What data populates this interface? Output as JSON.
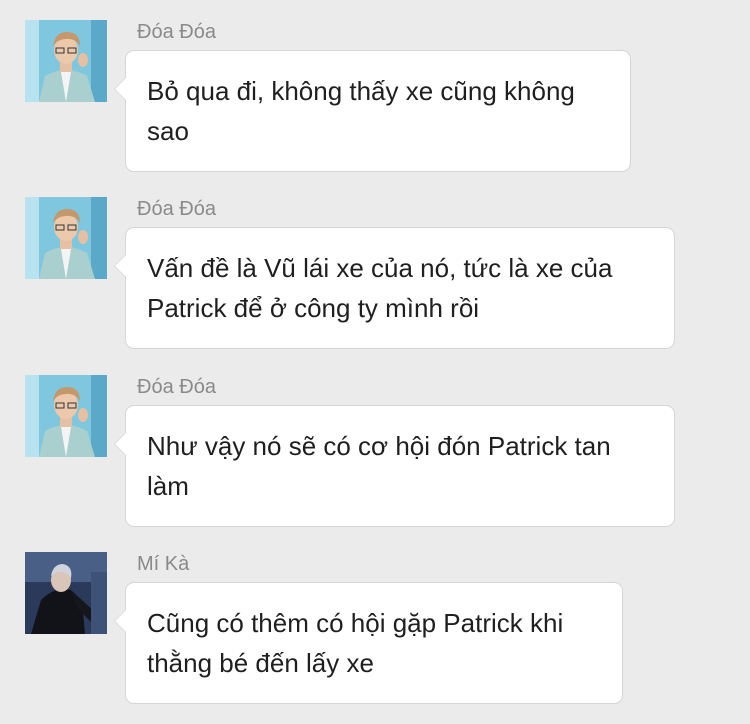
{
  "messages": [
    {
      "sender": "Đóa Đóa",
      "avatar": "avatar-photo",
      "text": "Bỏ qua đi, không thấy xe cũng không sao"
    },
    {
      "sender": "Đóa Đóa",
      "avatar": "avatar-photo",
      "text": "Vấn đề là Vũ lái xe của nó, tức là xe của Patrick để ở công ty mình rồi"
    },
    {
      "sender": "Đóa Đóa",
      "avatar": "avatar-photo",
      "text": "Như vậy nó sẽ có cơ hội đón Patrick tan làm"
    },
    {
      "sender": "Mí Kà",
      "avatar": "avatar-photo",
      "text": "Cũng có thêm có hội gặp Patrick khi thằng bé đến lấy xe"
    }
  ],
  "colors": {
    "background": "#ebebeb",
    "bubble": "#ffffff",
    "bubble_border": "#d6d6d6",
    "sender_name": "#8a8a8a",
    "message_text": "#1f1f1f"
  }
}
